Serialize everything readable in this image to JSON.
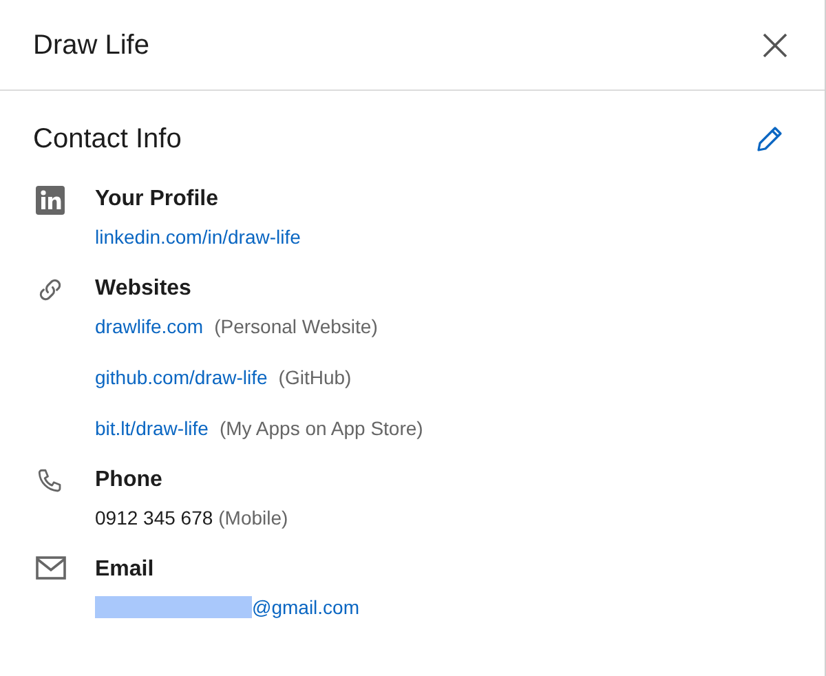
{
  "dialog": {
    "title": "Draw Life"
  },
  "contact_info": {
    "heading": "Contact Info",
    "sections": [
      {
        "kind": "profile",
        "heading": "Your Profile",
        "entries": [
          {
            "link": "linkedin.com/in/draw-life"
          }
        ]
      },
      {
        "kind": "websites",
        "heading": "Websites",
        "entries": [
          {
            "link": "drawlife.com",
            "note": "(Personal Website)"
          },
          {
            "link": "github.com/draw-life",
            "note": "(GitHub)"
          },
          {
            "link": "bit.lt/draw-life",
            "note": "(My Apps on App Store)"
          }
        ]
      },
      {
        "kind": "phone",
        "heading": "Phone",
        "entries": [
          {
            "text": "0912 345 678",
            "note": "(Mobile)"
          }
        ]
      },
      {
        "kind": "email",
        "heading": "Email",
        "entries": [
          {
            "redacted": true,
            "link": "@gmail.com"
          }
        ]
      }
    ]
  }
}
